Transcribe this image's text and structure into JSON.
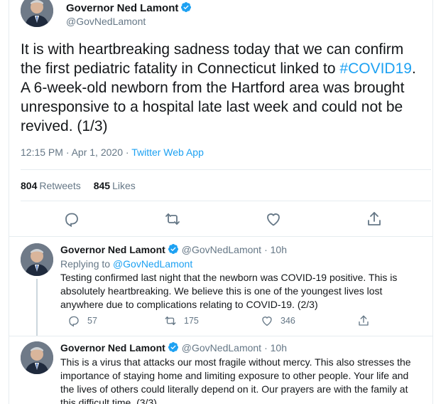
{
  "main_tweet": {
    "author_name": "Governor Ned Lamont",
    "author_handle": "@GovNedLamont",
    "text_before": "It is with heartbreaking sadness today that we can confirm the first pediatric fatality in Connecticut linked to ",
    "hashtag": "#COVID19",
    "text_after": ". A 6-week-old newborn from the Hartford area was brought unresponsive to a hospital late last week and could not be revived. (1/3)",
    "time": "12:15 PM · Apr 1, 2020",
    "separator": " · ",
    "source": "Twitter Web App",
    "retweets_count": "804",
    "retweets_label": "Retweets",
    "likes_count": "845",
    "likes_label": "Likes",
    "actions": [
      "reply-icon",
      "retweet-icon",
      "like-icon",
      "share-icon"
    ]
  },
  "replies": [
    {
      "author_name": "Governor Ned Lamont",
      "author_handle": "@GovNedLamont",
      "time": "· 10h",
      "replying_prefix": "Replying to ",
      "replying_to": "@GovNedLamont",
      "text": "Testing confirmed last night that the newborn was COVID-19 positive. This is absolutely heartbreaking. We believe this is one of the youngest lives lost anywhere due to complications relating to COVID-19. (2/3)",
      "reply_count": "57",
      "retweet_count": "175",
      "like_count": "346"
    },
    {
      "author_name": "Governor Ned Lamont",
      "author_handle": "@GovNedLamont",
      "time": "· 10h",
      "text": "This is a virus that attacks our most fragile without mercy. This also stresses the importance of staying home and limiting exposure to other people. Your life and the lives of others could literally depend on it. Our prayers are with the family at this difficult time. (3/3)"
    }
  ],
  "colors": {
    "accent": "#1da1f2",
    "text": "#14171a",
    "muted": "#657786",
    "border": "#e6ecf0",
    "verified": "#1da1f2"
  }
}
